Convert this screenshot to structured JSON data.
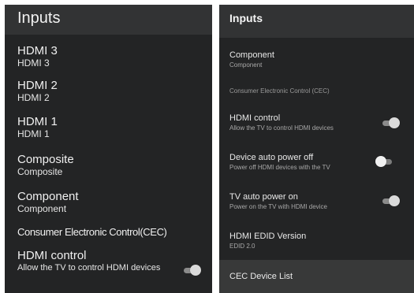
{
  "left_panel": {
    "title": "Inputs",
    "items": [
      {
        "title": "HDMI 3",
        "sub": "HDMI 3"
      },
      {
        "title": "HDMI 2",
        "sub": "HDMI 2"
      },
      {
        "title": "HDMI 1",
        "sub": "HDMI 1"
      },
      {
        "title": "Composite",
        "sub": "Composite"
      },
      {
        "title": "Component",
        "sub": "Component"
      }
    ],
    "cec_label": "Consumer Electronic Control(CEC)",
    "hdmi_control": {
      "title": "HDMI control",
      "sub": "Allow the TV to control HDMI devices",
      "enabled": true
    }
  },
  "right_panel": {
    "title": "Inputs",
    "component": {
      "title": "Component",
      "sub": "Component"
    },
    "cec_section": "Consumer Electronic Control (CEC)",
    "hdmi_control": {
      "title": "HDMI control",
      "sub": "Allow the TV to control HDMI devices",
      "enabled": true
    },
    "device_auto_power_off": {
      "title": "Device auto power off",
      "sub": "Power off HDMI devices with the TV",
      "enabled": false
    },
    "tv_auto_power_on": {
      "title": "TV auto power on",
      "sub": "Power on the TV with HDMI device",
      "enabled": true
    },
    "hdmi_edid_version": {
      "title": "HDMI EDID Version",
      "sub": "EDID 2.0"
    },
    "cec_device_list": "CEC Device List"
  }
}
